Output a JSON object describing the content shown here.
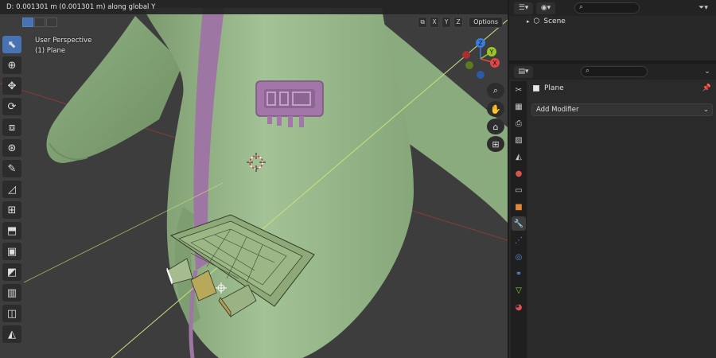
{
  "viewport": {
    "status_text": "D: 0.001301 m (0.001301 m) along global Y",
    "perspective_label": "User Perspective",
    "object_label": "(1) Plane",
    "options_label": "Options",
    "header_buttons": [
      "X",
      "Y",
      "Z"
    ],
    "gizmo_axes": {
      "z": "Z",
      "y": "Y",
      "x": "X"
    },
    "colors": {
      "x_axis": "#e04848",
      "y_axis": "#9ac628",
      "z_axis": "#3a7de0",
      "mesh": "#97b98a"
    }
  },
  "toolbar": {
    "tools": [
      {
        "name": "select-box-tool",
        "icon": "cursor-icon",
        "active": true
      },
      {
        "name": "cursor-tool",
        "icon": "crosshair-icon"
      },
      {
        "name": "move-tool",
        "icon": "move-icon"
      },
      {
        "name": "rotate-tool",
        "icon": "rotate-icon"
      },
      {
        "name": "scale-tool",
        "icon": "scale-icon"
      },
      {
        "name": "transform-tool",
        "icon": "transform-icon"
      },
      {
        "name": "annotate-tool",
        "icon": "pencil-icon"
      },
      {
        "name": "measure-tool",
        "icon": "ruler-icon"
      },
      {
        "name": "add-cube-tool",
        "icon": "add-cube-icon"
      },
      {
        "name": "extrude-tool",
        "icon": "extrude-icon"
      },
      {
        "name": "inset-tool",
        "icon": "inset-icon"
      },
      {
        "name": "bevel-tool",
        "icon": "bevel-icon"
      },
      {
        "name": "loop-cut-tool",
        "icon": "loop-cut-icon"
      },
      {
        "name": "knife-tool",
        "icon": "knife-icon"
      },
      {
        "name": "poly-build-tool",
        "icon": "poly-build-icon"
      }
    ]
  },
  "outliner": {
    "search_placeholder": "",
    "scene_label": "Scene"
  },
  "properties": {
    "object_name": "Plane",
    "add_modifier_label": "Add Modifier",
    "tabs": [
      "tool-icon",
      "render-icon",
      "output-icon",
      "view-layer-icon",
      "scene-icon",
      "world-icon",
      "collection-icon",
      "object-icon",
      "modifier-icon",
      "particles-icon",
      "physics-icon",
      "constraints-icon",
      "data-icon",
      "material-icon"
    ]
  }
}
